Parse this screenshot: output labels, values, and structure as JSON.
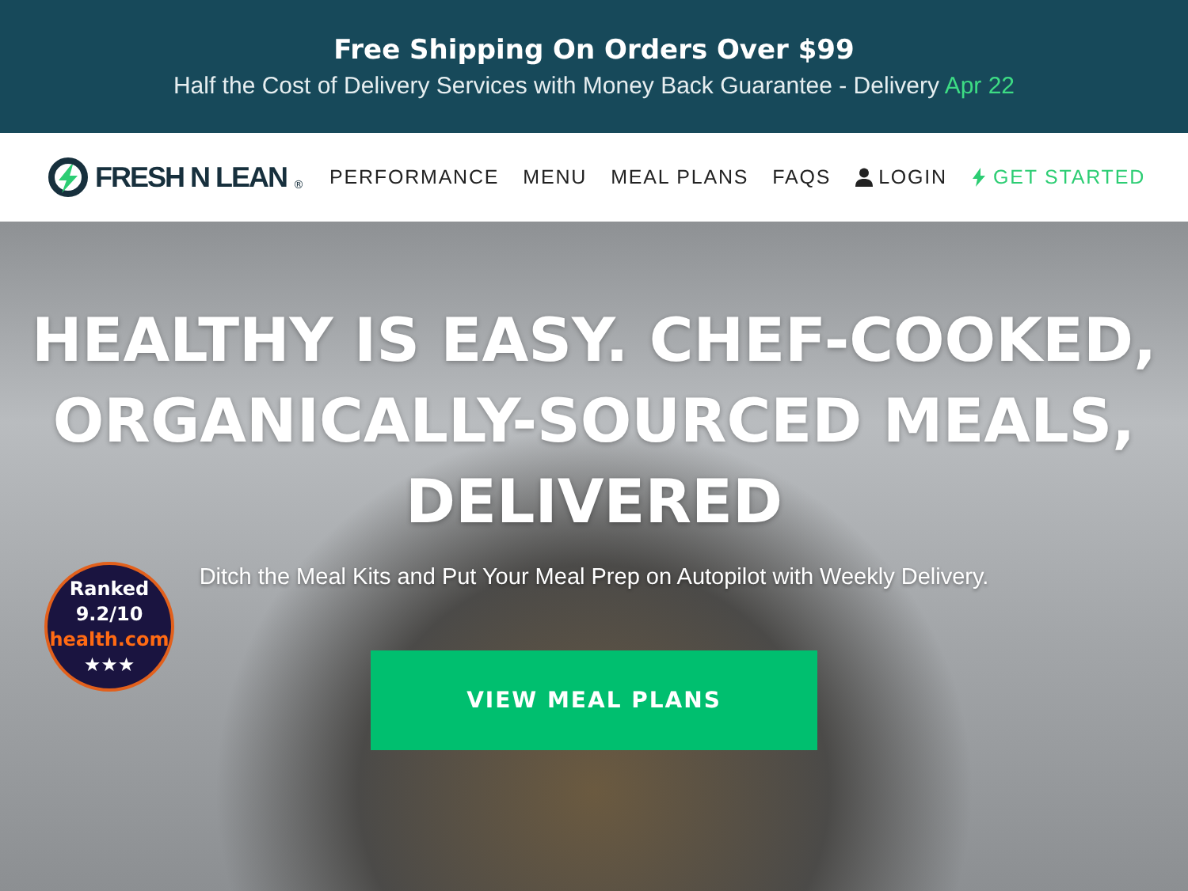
{
  "promo_bar": {
    "title": "Free Shipping On Orders Over $99",
    "subtitle": "Half the Cost of Delivery Services with Money Back Guarantee - Delivery",
    "delivery_date": "Apr 22"
  },
  "nav": {
    "logo_text": "FRESH N LEAN",
    "logo_mark": "®",
    "items": [
      {
        "label": "PERFORMANCE",
        "kind": "plain"
      },
      {
        "label": "MENU",
        "kind": "plain"
      },
      {
        "label": "MEAL PLANS",
        "kind": "plain"
      },
      {
        "label": "FAQS",
        "kind": "plain"
      },
      {
        "label": "LOGIN",
        "kind": "user"
      },
      {
        "label": "GET STARTED",
        "kind": "cta"
      }
    ]
  },
  "hero": {
    "headline": "HEALTHY IS EASY. CHEF-COOKED, ORGANICALLY-SOURCED MEALS, DELIVERED",
    "subtitle": "Ditch the Meal Kits and Put Your Meal Prep on Autopilot with Weekly Delivery.",
    "button": "VIEW MEAL PLANS",
    "badge": {
      "label": "Ranked",
      "score": "9.2/10",
      "source": "health.com",
      "stars": "★★★"
    }
  }
}
